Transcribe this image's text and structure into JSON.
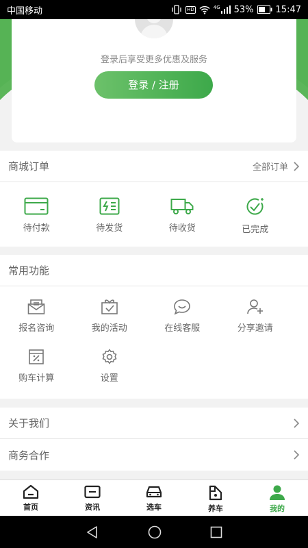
{
  "status_bar": {
    "carrier": "中国移动",
    "battery": "53%",
    "time": "15:47",
    "hd_badge": "HD",
    "network": "4G"
  },
  "profile": {
    "hint": "登录后享受更多优惠及服务",
    "login_label": "登录 / 注册"
  },
  "orders": {
    "title": "商城订单",
    "all_label": "全部订单",
    "items": [
      {
        "label": "待付款",
        "icon": "card-icon"
      },
      {
        "label": "待发货",
        "icon": "dispatch-icon"
      },
      {
        "label": "待收货",
        "icon": "truck-icon"
      },
      {
        "label": "已完成",
        "icon": "check-circle-icon"
      }
    ]
  },
  "features": {
    "title": "常用功能",
    "items": [
      {
        "label": "报名咨询",
        "icon": "envelope-icon"
      },
      {
        "label": "我的活动",
        "icon": "gift-icon"
      },
      {
        "label": "在线客服",
        "icon": "chat-icon"
      },
      {
        "label": "分享邀请",
        "icon": "user-add-icon"
      },
      {
        "label": "购车计算",
        "icon": "calculator-icon"
      },
      {
        "label": "设置",
        "icon": "gear-icon"
      }
    ]
  },
  "links": [
    {
      "label": "关于我们"
    },
    {
      "label": "商务合作"
    }
  ],
  "tabs": [
    {
      "label": "首页",
      "icon": "home-icon"
    },
    {
      "label": "资讯",
      "icon": "news-icon"
    },
    {
      "label": "选车",
      "icon": "car-icon"
    },
    {
      "label": "养车",
      "icon": "car-care-icon"
    },
    {
      "label": "我的",
      "icon": "profile-icon",
      "active": true
    }
  ],
  "colors": {
    "accent": "#3da94a",
    "accent_light": "#6cc16a",
    "text": "#666666",
    "background": "#f2f2f2"
  }
}
